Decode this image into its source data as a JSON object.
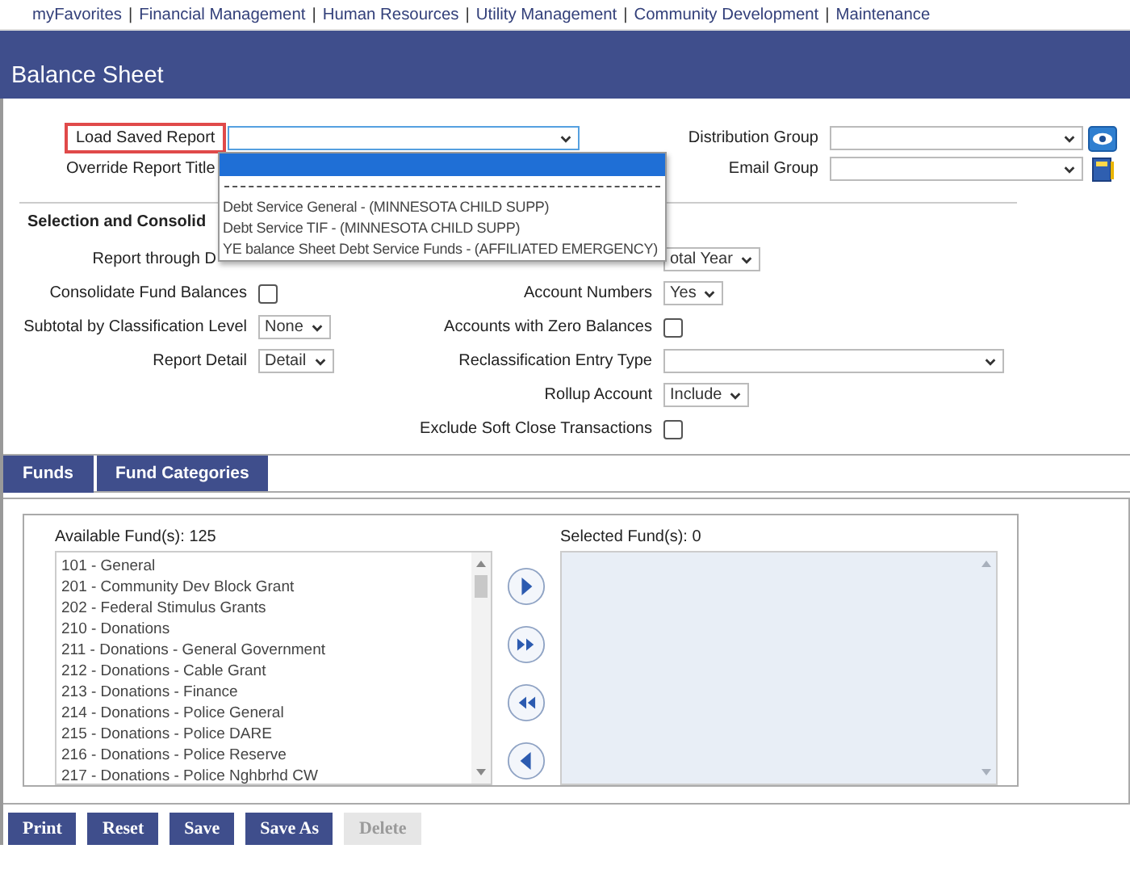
{
  "nav": {
    "separator": "|",
    "items": [
      "myFavorites",
      "Financial Management",
      "Human Resources",
      "Utility Management",
      "Community Development",
      "Maintenance"
    ]
  },
  "title": "Balance Sheet",
  "load_saved_report": {
    "label": "Load Saved Report",
    "highlighted": true
  },
  "override_title": {
    "label": "Override Report Title"
  },
  "distribution_group": {
    "label": "Distribution Group"
  },
  "email_group": {
    "label": "Email Group"
  },
  "dropdown_options": [
    {
      "kind": "blank",
      "selected": true
    },
    {
      "kind": "separator",
      "selected": false
    },
    {
      "kind": "option",
      "label": "Debt Service General - (MINNESOTA CHILD SUPP)",
      "selected": false
    },
    {
      "kind": "option",
      "label": "Debt Service TIF - (MINNESOTA CHILD SUPP)",
      "selected": false
    },
    {
      "kind": "option",
      "label": "YE balance Sheet Debt Service Funds - (AFFILIATED EMERGENCY)",
      "selected": false
    }
  ],
  "section_heading": "Selection and Consolid",
  "rows": [
    {
      "left": {
        "label": "Report through D",
        "kind": "none"
      },
      "right": {
        "kind": "select",
        "value": "otal Year"
      }
    },
    {
      "left": {
        "label": "Consolidate Fund Balances",
        "kind": "checkbox",
        "checked": false
      },
      "right": {
        "label": "Account Numbers",
        "kind": "select",
        "value": "Yes"
      }
    },
    {
      "left": {
        "label": "Subtotal by Classification Level",
        "kind": "select",
        "value": "None"
      },
      "right": {
        "label": "Accounts with Zero Balances",
        "kind": "checkbox",
        "checked": false
      }
    },
    {
      "left": {
        "label": "Report Detail",
        "kind": "select",
        "value": "Detail"
      },
      "right": {
        "label": "Reclassification Entry Type",
        "kind": "long-select"
      }
    },
    {
      "right": {
        "label": "Rollup Account",
        "kind": "select",
        "value": "Include"
      }
    },
    {
      "right": {
        "label": "Exclude Soft Close Transactions",
        "kind": "checkbox",
        "checked": false
      }
    }
  ],
  "tabs": [
    {
      "label": "Funds",
      "selected": true
    },
    {
      "label": "Fund Categories",
      "selected": false
    }
  ],
  "available": {
    "label": "Available Fund(s): 125",
    "items": [
      "101 - General",
      "201 - Community Dev Block Grant",
      "202 - Federal Stimulus Grants",
      "210 - Donations",
      "211 - Donations - General Government",
      "212 - Donations - Cable Grant",
      "213 - Donations - Finance",
      "214 - Donations - Police General",
      "215 - Donations - Police DARE",
      "216 - Donations - Police Reserve",
      "217 - Donations - Police Nghbrhd CW"
    ]
  },
  "selected_funds": {
    "label": "Selected Fund(s): 0"
  },
  "transfer_buttons": [
    {
      "kind": "add"
    },
    {
      "kind": "add-all"
    },
    {
      "kind": "remove-all"
    },
    {
      "kind": "remove"
    }
  ],
  "buttons": [
    {
      "label": "Print",
      "disabled": false
    },
    {
      "label": "Reset",
      "disabled": false
    },
    {
      "label": "Save",
      "disabled": false
    },
    {
      "label": "Save As",
      "disabled": false
    },
    {
      "label": "Delete",
      "disabled": true
    }
  ]
}
